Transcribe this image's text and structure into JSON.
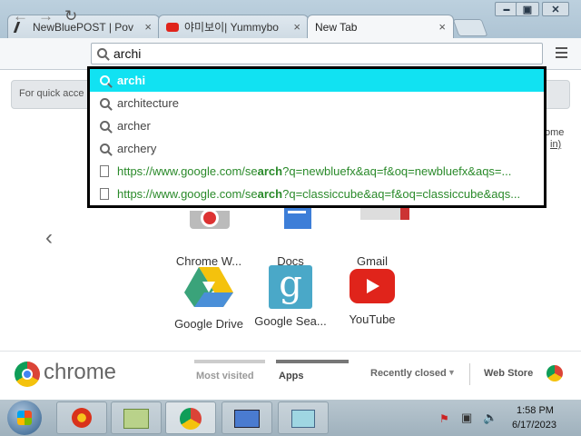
{
  "window": {
    "tabs": [
      {
        "title": "NewBluePOST | Pov"
      },
      {
        "title": "야미보이| Yummybo"
      },
      {
        "title": "New Tab"
      }
    ],
    "controls": {
      "minimize": "▬",
      "maximize": "▣",
      "close": "✕"
    }
  },
  "toolbar": {
    "omnibox_value": "archi"
  },
  "page": {
    "quickbar_text": "For quick acce",
    "signin_partial_1": "ome",
    "signin_partial_2": "in)"
  },
  "dropdown": {
    "suggestions": [
      {
        "type": "search",
        "text": "archi",
        "highlight": true
      },
      {
        "type": "search",
        "text": "architecture"
      },
      {
        "type": "search",
        "text": "archer"
      },
      {
        "type": "search",
        "text": "archery"
      },
      {
        "type": "url",
        "prefix": "https://www.google.com/se",
        "bold": "arch",
        "suffix": "?q=newbluefx&aq=f&oq=newbluefx&aqs=..."
      },
      {
        "type": "url",
        "prefix": "https://www.google.com/se",
        "bold": "arch",
        "suffix": "?q=classiccube&aq=f&oq=classiccube&aqs..."
      }
    ]
  },
  "apps": [
    {
      "label": "Chrome W..."
    },
    {
      "label": "Docs"
    },
    {
      "label": "Gmail"
    },
    {
      "label": "Google Drive"
    },
    {
      "label": "Google Sea..."
    },
    {
      "label": "YouTube"
    }
  ],
  "footer": {
    "brand": "chrome",
    "most_visited": "Most visited",
    "apps": "Apps",
    "recently_closed": "Recently closed",
    "web_store": "Web Store"
  },
  "taskbar": {
    "time": "1:58 PM",
    "date": "6/17/2023"
  },
  "colors": {
    "highlight": "#11e2f2",
    "url_green": "#2a8a2a",
    "youtube_red": "#e0241b"
  }
}
